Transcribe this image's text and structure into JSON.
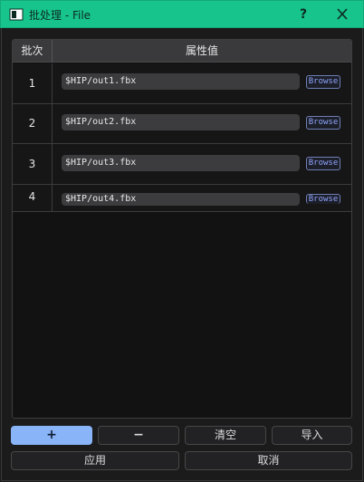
{
  "window": {
    "title": "批处理 - File",
    "help_label": "?"
  },
  "table": {
    "headers": [
      "批次",
      "属性值"
    ],
    "rows": [
      {
        "index": "1",
        "value": "$HIP/out1.fbx",
        "browse_label": "Browse"
      },
      {
        "index": "2",
        "value": "$HIP/out2.fbx",
        "browse_label": "Browse"
      },
      {
        "index": "3",
        "value": "$HIP/out3.fbx",
        "browse_label": "Browse"
      },
      {
        "index": "4",
        "value": "$HIP/out4.fbx",
        "browse_label": "Browse"
      }
    ]
  },
  "buttons": {
    "add_label": "+",
    "remove_label": "−",
    "clear_label": "清空",
    "import_label": "导入",
    "apply_label": "应用",
    "cancel_label": "取消"
  },
  "colors": {
    "titlebar": "#17c48c",
    "accent": "#8ab4f8",
    "browse_text": "#8fa6ff"
  }
}
